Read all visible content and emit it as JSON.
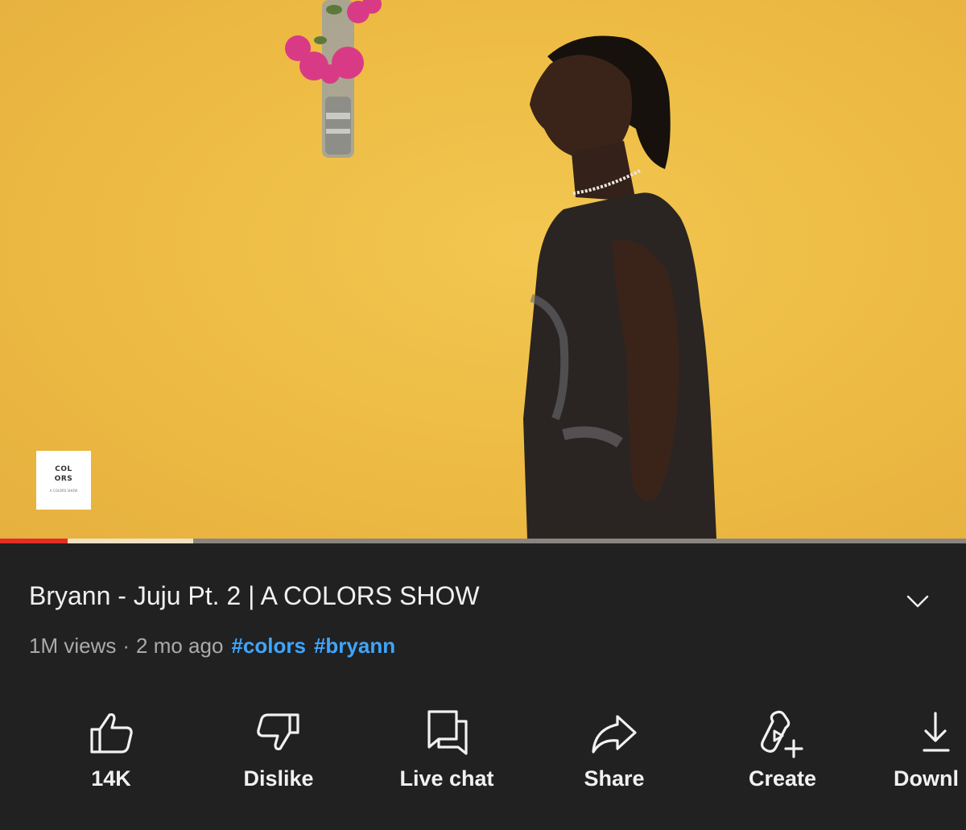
{
  "player": {
    "logo_line1": "COL",
    "logo_line2": "ORS",
    "logo_small": "A COLORS SHOW",
    "progress_played_fraction": 0.07,
    "progress_buffered_fraction": 0.2
  },
  "video": {
    "title": "Bryann - Juju Pt. 2 | A COLORS SHOW",
    "views": "1M views",
    "separator": "·",
    "age": "2 mo ago",
    "hashtags": [
      "#colors",
      "#bryann"
    ]
  },
  "actions": [
    {
      "label": "14K",
      "icon": "thumbs-up-icon"
    },
    {
      "label": "Dislike",
      "icon": "thumbs-down-icon"
    },
    {
      "label": "Live chat",
      "icon": "chat-icon"
    },
    {
      "label": "Share",
      "icon": "share-icon"
    },
    {
      "label": "Create",
      "icon": "create-icon"
    },
    {
      "label": "Downl",
      "icon": "download-icon"
    }
  ],
  "colors": {
    "background": "#212121",
    "accent_link": "#3ea6ff",
    "progress_played": "#e52d27",
    "video_backdrop": "#edbb43"
  }
}
